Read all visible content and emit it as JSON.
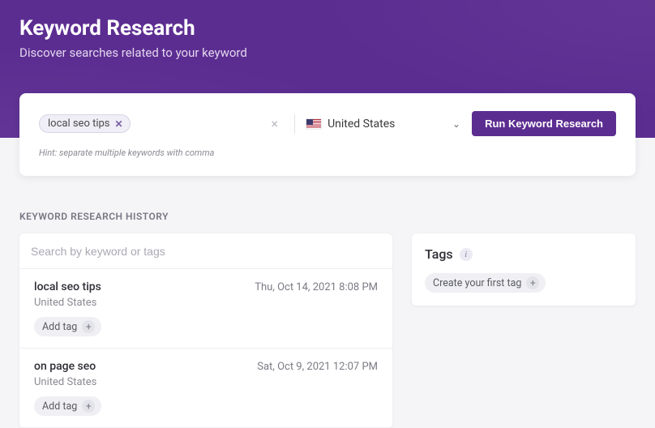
{
  "header": {
    "title": "Keyword Research",
    "subtitle": "Discover searches related to your keyword"
  },
  "search": {
    "chip": "local seo tips",
    "hint": "Hint: separate multiple keywords with comma",
    "country": "United States",
    "runLabel": "Run Keyword Research"
  },
  "sectionLabel": "KEYWORD RESEARCH HISTORY",
  "history": {
    "searchPlaceholder": "Search by keyword or tags",
    "addTagLabel": "Add tag",
    "items": [
      {
        "keyword": "local seo tips",
        "country": "United States",
        "date": "Thu, Oct 14, 2021 8:08 PM"
      },
      {
        "keyword": "on page seo",
        "country": "United States",
        "date": "Sat, Oct 9, 2021 12:07 PM"
      }
    ]
  },
  "tagsPanel": {
    "title": "Tags",
    "createLabel": "Create your first tag"
  }
}
